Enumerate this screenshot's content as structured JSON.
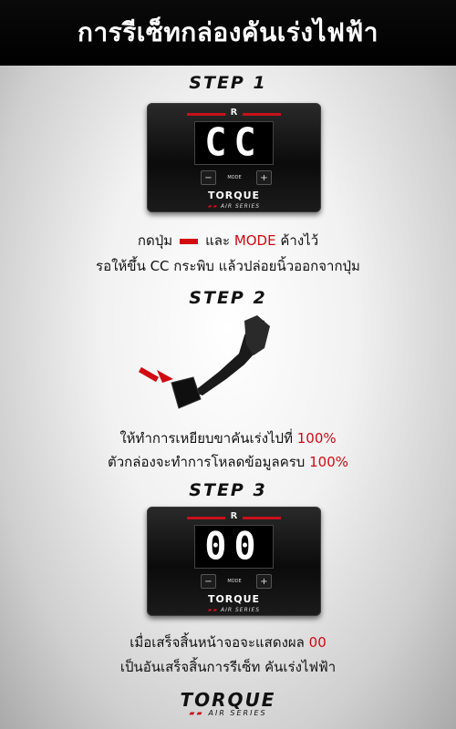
{
  "header": {
    "title": "การรีเซ็ทกล่องคันเร่งไฟฟ้า"
  },
  "step1": {
    "title": "STEP 1",
    "device": {
      "logo": "R",
      "display": "CC",
      "mode_label": "MODE",
      "minus_label": "−",
      "plus_label": "+",
      "brand": "TORQUE",
      "series": "AIR SERIES"
    },
    "line1_pre": "กดปุ่ม",
    "line1_and": "และ",
    "line1_mode": "MODE",
    "line1_post": "ค้างไว้",
    "line2": "รอให้ขึ้น CC กระพิบ แล้วปล่อยนิ้วออกจากปุ่ม"
  },
  "step2": {
    "title": "STEP 2",
    "line1_text": "ให้ทำการเหยียบขาคันเร่งไปที่",
    "line1_value": "100%",
    "line2_text": "ตัวกล่องจะทำการโหลดข้อมูลครบ",
    "line2_value": "100%"
  },
  "step3": {
    "title": "STEP 3",
    "device": {
      "logo": "R",
      "display": "00",
      "mode_label": "MODE",
      "minus_label": "−",
      "plus_label": "+",
      "brand": "TORQUE",
      "series": "AIR SERIES"
    },
    "line1_text": "เมื่อเสร็จสิ้นหน้าจอจะแสดงผล",
    "line1_value": "00",
    "line2": "เป็นอันเสร็จสิ้นการรีเซ็ท คันเร่งไฟฟ้า"
  },
  "footer": {
    "brand": "TORQUE",
    "series": "AIR SERIES"
  },
  "colors": {
    "accent_red": "#d10a12",
    "header_bg": "#000000"
  }
}
